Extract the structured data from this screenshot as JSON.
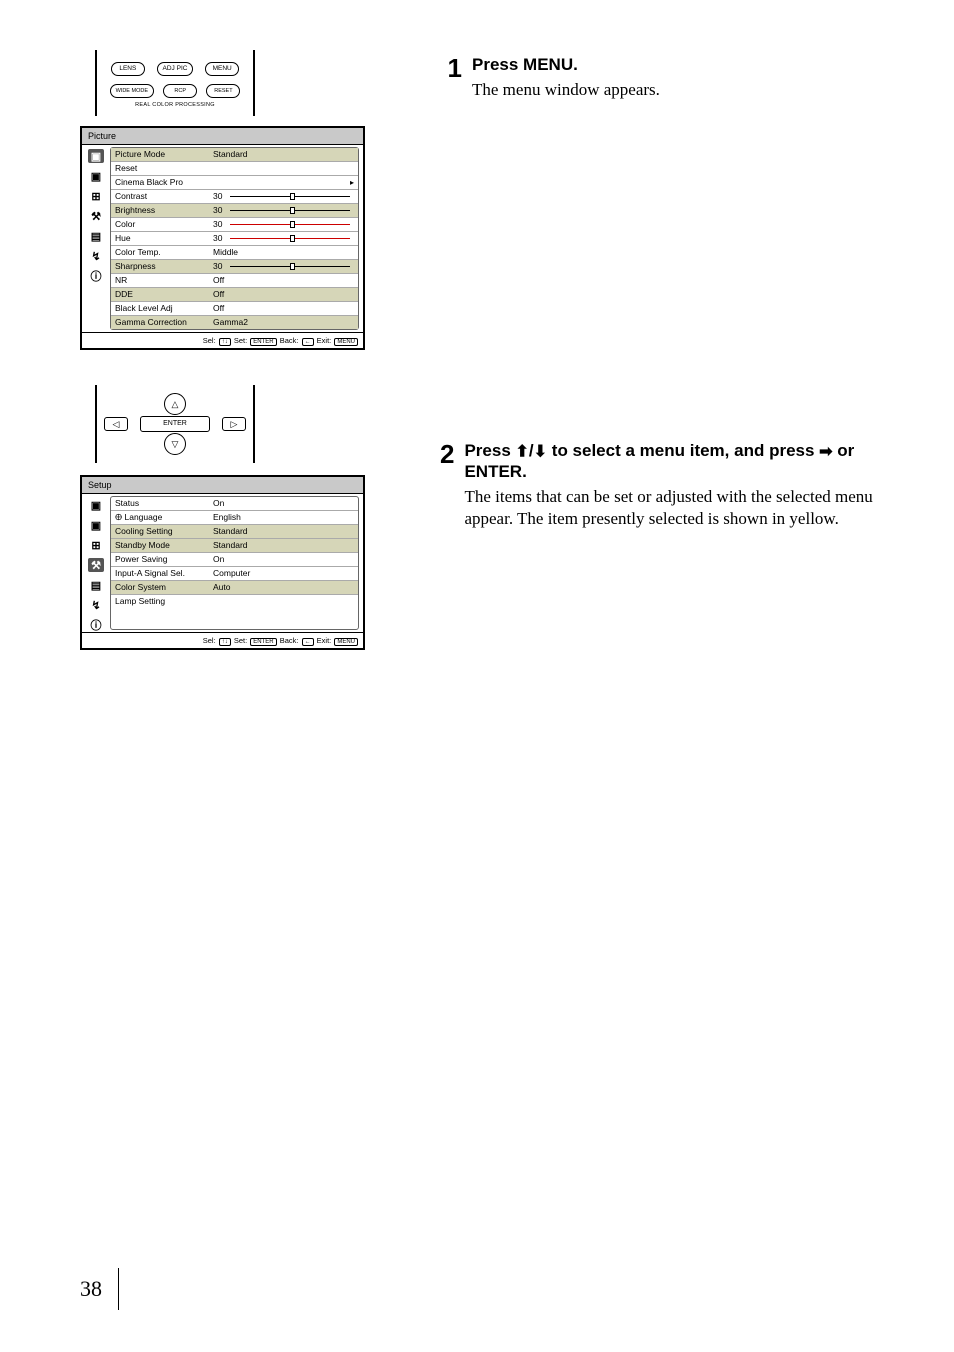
{
  "remote_top": {
    "row1": [
      "LENS",
      "ADJ PIC",
      "MENU"
    ],
    "row2": [
      "WIDE MODE",
      "RCP",
      "RESET"
    ],
    "caption": "REAL COLOR PROCESSING"
  },
  "panel1": {
    "title": "Picture",
    "rows": [
      {
        "label": "Picture Mode",
        "value": "Standard",
        "hl": true
      },
      {
        "label": "Reset",
        "value": ""
      },
      {
        "label": "Cinema Black Pro",
        "value": "",
        "arrow": true
      },
      {
        "label": "Contrast",
        "value": "30",
        "slider": true
      },
      {
        "label": "Brightness",
        "value": "30",
        "slider": true,
        "hl": true
      },
      {
        "label": "Color",
        "value": "30",
        "slider": true,
        "red": true
      },
      {
        "label": "Hue",
        "value": "30",
        "slider": true,
        "red": true
      },
      {
        "label": "Color Temp.",
        "value": "Middle"
      },
      {
        "label": "Sharpness",
        "value": "30",
        "slider": true,
        "hl": true
      },
      {
        "label": "NR",
        "value": "Off"
      },
      {
        "label": "DDE",
        "value": "Off",
        "hl": true
      },
      {
        "label": "Black Level Adj",
        "value": "Off"
      },
      {
        "label": "Gamma Correction",
        "value": "Gamma2",
        "hl": true
      }
    ]
  },
  "footer": {
    "sel": "Sel:",
    "set": "Set:",
    "back": "Back:",
    "exit": "Exit:",
    "k_arrows": "↑↓",
    "k_enter": "ENTER",
    "k_back": "←",
    "k_menu": "MENU"
  },
  "dpad": {
    "enter": "ENTER"
  },
  "panel2": {
    "title": "Setup",
    "rows": [
      {
        "label": "Status",
        "value": "On"
      },
      {
        "label": "Language",
        "value": "English",
        "globe": true
      },
      {
        "label": "Cooling Setting",
        "value": "Standard",
        "hl": true
      },
      {
        "label": "Standby Mode",
        "value": "Standard",
        "hl": true
      },
      {
        "label": "Power Saving",
        "value": "On"
      },
      {
        "label": "Input-A Signal Sel.",
        "value": "Computer"
      },
      {
        "label": "Color System",
        "value": "Auto",
        "hl": true
      },
      {
        "label": "Lamp Setting",
        "value": ""
      }
    ]
  },
  "icons": [
    "▣",
    "▣",
    "⊞",
    "⚒",
    "▤",
    "↯",
    "ⓘ"
  ],
  "steps": [
    {
      "num": "1",
      "title": "Press MENU.",
      "desc": "The menu window appears."
    },
    {
      "num": "2",
      "title_parts": [
        "Press ",
        "↑",
        "/",
        "↓",
        " to select a menu item, and press ",
        "→",
        " or ENTER."
      ],
      "desc": "The items that can be set or adjusted with the selected menu appear. The item presently selected is shown in yellow."
    }
  ],
  "page_number": "38"
}
